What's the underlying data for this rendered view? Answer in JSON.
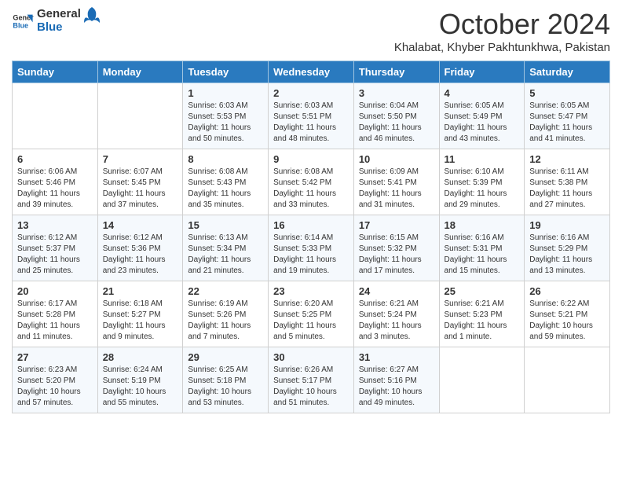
{
  "header": {
    "logo_line1": "General",
    "logo_line2": "Blue",
    "month": "October 2024",
    "location": "Khalabat, Khyber Pakhtunkhwa, Pakistan"
  },
  "days_of_week": [
    "Sunday",
    "Monday",
    "Tuesday",
    "Wednesday",
    "Thursday",
    "Friday",
    "Saturday"
  ],
  "weeks": [
    [
      {
        "day": "",
        "sunrise": "",
        "sunset": "",
        "daylight": ""
      },
      {
        "day": "",
        "sunrise": "",
        "sunset": "",
        "daylight": ""
      },
      {
        "day": "1",
        "sunrise": "Sunrise: 6:03 AM",
        "sunset": "Sunset: 5:53 PM",
        "daylight": "Daylight: 11 hours and 50 minutes."
      },
      {
        "day": "2",
        "sunrise": "Sunrise: 6:03 AM",
        "sunset": "Sunset: 5:51 PM",
        "daylight": "Daylight: 11 hours and 48 minutes."
      },
      {
        "day": "3",
        "sunrise": "Sunrise: 6:04 AM",
        "sunset": "Sunset: 5:50 PM",
        "daylight": "Daylight: 11 hours and 46 minutes."
      },
      {
        "day": "4",
        "sunrise": "Sunrise: 6:05 AM",
        "sunset": "Sunset: 5:49 PM",
        "daylight": "Daylight: 11 hours and 43 minutes."
      },
      {
        "day": "5",
        "sunrise": "Sunrise: 6:05 AM",
        "sunset": "Sunset: 5:47 PM",
        "daylight": "Daylight: 11 hours and 41 minutes."
      }
    ],
    [
      {
        "day": "6",
        "sunrise": "Sunrise: 6:06 AM",
        "sunset": "Sunset: 5:46 PM",
        "daylight": "Daylight: 11 hours and 39 minutes."
      },
      {
        "day": "7",
        "sunrise": "Sunrise: 6:07 AM",
        "sunset": "Sunset: 5:45 PM",
        "daylight": "Daylight: 11 hours and 37 minutes."
      },
      {
        "day": "8",
        "sunrise": "Sunrise: 6:08 AM",
        "sunset": "Sunset: 5:43 PM",
        "daylight": "Daylight: 11 hours and 35 minutes."
      },
      {
        "day": "9",
        "sunrise": "Sunrise: 6:08 AM",
        "sunset": "Sunset: 5:42 PM",
        "daylight": "Daylight: 11 hours and 33 minutes."
      },
      {
        "day": "10",
        "sunrise": "Sunrise: 6:09 AM",
        "sunset": "Sunset: 5:41 PM",
        "daylight": "Daylight: 11 hours and 31 minutes."
      },
      {
        "day": "11",
        "sunrise": "Sunrise: 6:10 AM",
        "sunset": "Sunset: 5:39 PM",
        "daylight": "Daylight: 11 hours and 29 minutes."
      },
      {
        "day": "12",
        "sunrise": "Sunrise: 6:11 AM",
        "sunset": "Sunset: 5:38 PM",
        "daylight": "Daylight: 11 hours and 27 minutes."
      }
    ],
    [
      {
        "day": "13",
        "sunrise": "Sunrise: 6:12 AM",
        "sunset": "Sunset: 5:37 PM",
        "daylight": "Daylight: 11 hours and 25 minutes."
      },
      {
        "day": "14",
        "sunrise": "Sunrise: 6:12 AM",
        "sunset": "Sunset: 5:36 PM",
        "daylight": "Daylight: 11 hours and 23 minutes."
      },
      {
        "day": "15",
        "sunrise": "Sunrise: 6:13 AM",
        "sunset": "Sunset: 5:34 PM",
        "daylight": "Daylight: 11 hours and 21 minutes."
      },
      {
        "day": "16",
        "sunrise": "Sunrise: 6:14 AM",
        "sunset": "Sunset: 5:33 PM",
        "daylight": "Daylight: 11 hours and 19 minutes."
      },
      {
        "day": "17",
        "sunrise": "Sunrise: 6:15 AM",
        "sunset": "Sunset: 5:32 PM",
        "daylight": "Daylight: 11 hours and 17 minutes."
      },
      {
        "day": "18",
        "sunrise": "Sunrise: 6:16 AM",
        "sunset": "Sunset: 5:31 PM",
        "daylight": "Daylight: 11 hours and 15 minutes."
      },
      {
        "day": "19",
        "sunrise": "Sunrise: 6:16 AM",
        "sunset": "Sunset: 5:29 PM",
        "daylight": "Daylight: 11 hours and 13 minutes."
      }
    ],
    [
      {
        "day": "20",
        "sunrise": "Sunrise: 6:17 AM",
        "sunset": "Sunset: 5:28 PM",
        "daylight": "Daylight: 11 hours and 11 minutes."
      },
      {
        "day": "21",
        "sunrise": "Sunrise: 6:18 AM",
        "sunset": "Sunset: 5:27 PM",
        "daylight": "Daylight: 11 hours and 9 minutes."
      },
      {
        "day": "22",
        "sunrise": "Sunrise: 6:19 AM",
        "sunset": "Sunset: 5:26 PM",
        "daylight": "Daylight: 11 hours and 7 minutes."
      },
      {
        "day": "23",
        "sunrise": "Sunrise: 6:20 AM",
        "sunset": "Sunset: 5:25 PM",
        "daylight": "Daylight: 11 hours and 5 minutes."
      },
      {
        "day": "24",
        "sunrise": "Sunrise: 6:21 AM",
        "sunset": "Sunset: 5:24 PM",
        "daylight": "Daylight: 11 hours and 3 minutes."
      },
      {
        "day": "25",
        "sunrise": "Sunrise: 6:21 AM",
        "sunset": "Sunset: 5:23 PM",
        "daylight": "Daylight: 11 hours and 1 minute."
      },
      {
        "day": "26",
        "sunrise": "Sunrise: 6:22 AM",
        "sunset": "Sunset: 5:21 PM",
        "daylight": "Daylight: 10 hours and 59 minutes."
      }
    ],
    [
      {
        "day": "27",
        "sunrise": "Sunrise: 6:23 AM",
        "sunset": "Sunset: 5:20 PM",
        "daylight": "Daylight: 10 hours and 57 minutes."
      },
      {
        "day": "28",
        "sunrise": "Sunrise: 6:24 AM",
        "sunset": "Sunset: 5:19 PM",
        "daylight": "Daylight: 10 hours and 55 minutes."
      },
      {
        "day": "29",
        "sunrise": "Sunrise: 6:25 AM",
        "sunset": "Sunset: 5:18 PM",
        "daylight": "Daylight: 10 hours and 53 minutes."
      },
      {
        "day": "30",
        "sunrise": "Sunrise: 6:26 AM",
        "sunset": "Sunset: 5:17 PM",
        "daylight": "Daylight: 10 hours and 51 minutes."
      },
      {
        "day": "31",
        "sunrise": "Sunrise: 6:27 AM",
        "sunset": "Sunset: 5:16 PM",
        "daylight": "Daylight: 10 hours and 49 minutes."
      },
      {
        "day": "",
        "sunrise": "",
        "sunset": "",
        "daylight": ""
      },
      {
        "day": "",
        "sunrise": "",
        "sunset": "",
        "daylight": ""
      }
    ]
  ]
}
